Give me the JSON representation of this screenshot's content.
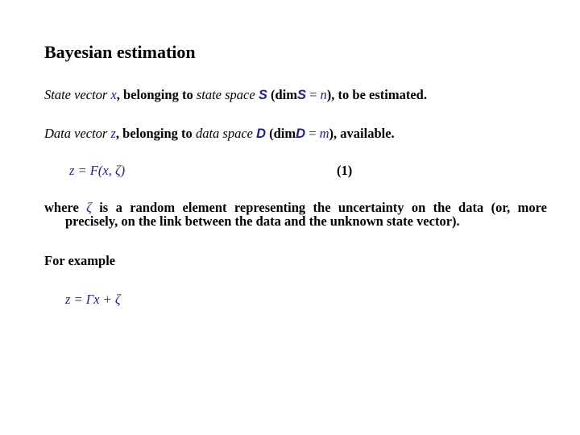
{
  "slide": {
    "title": "Bayesian estimation",
    "state_line": {
      "p1": "State vector ",
      "var": "x",
      "p2": ", belonging to ",
      "p3": "state space",
      "space": "S",
      "p4": " (dim",
      "space2": "S",
      "eq": " = ",
      "dim": "n",
      "p5": "), to be estimated."
    },
    "data_line": {
      "p1": "Data vector ",
      "var": "z",
      "p2": ", belonging to ",
      "p3": "data space",
      "space": "D",
      "p4": " (dim",
      "space2": "D",
      "eq": " = ",
      "dim": "m",
      "p5": "), available."
    },
    "equation1": {
      "text": "z = F(x, ζ)",
      "number": "(1)"
    },
    "explanation": {
      "p1": "where ",
      "symbol": "ζ",
      "p2": " is a random element representing the uncertainty on the data (or, more",
      "p3": "precisely, on the link between the data and the unknown state vector)."
    },
    "example_label": "For example",
    "equation2": "z = Γx + ζ",
    "colors": {
      "math_blue": "#1f1f8f",
      "text": "#000000",
      "background": "#ffffff"
    }
  }
}
